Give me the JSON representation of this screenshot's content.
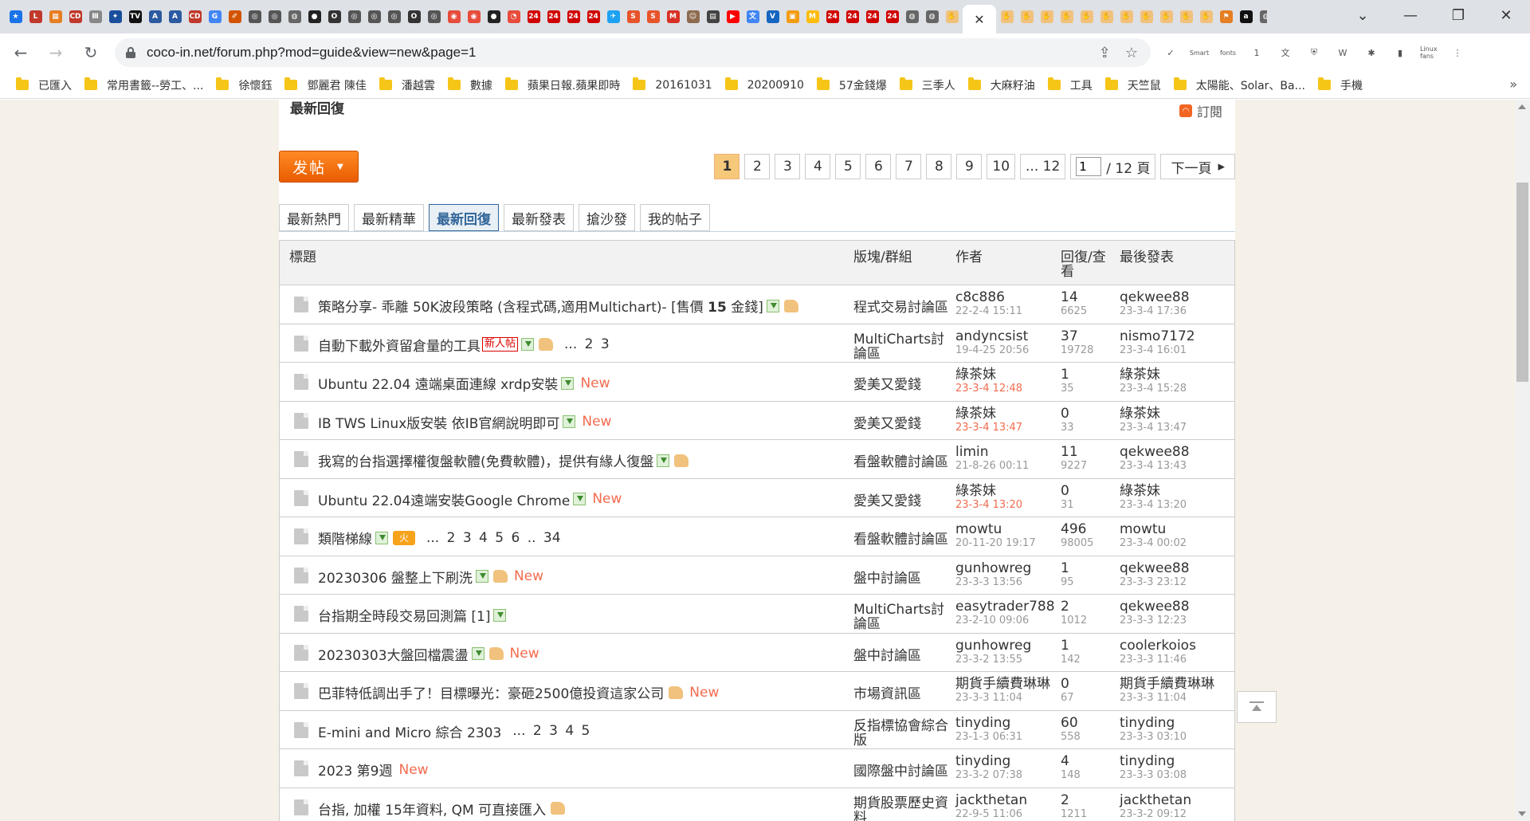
{
  "browser": {
    "tab_icons": [
      {
        "name": "star-icon",
        "glyph": "★",
        "color": "#1a73e8"
      },
      {
        "name": "red-app-icon",
        "glyph": "L",
        "color": "#c0392b"
      },
      {
        "name": "grid-app-icon",
        "glyph": "▦",
        "color": "#e67e22"
      },
      {
        "name": "cd-icon",
        "glyph": "CD",
        "color": "#c0392b"
      },
      {
        "name": "page-icon",
        "glyph": "Ⅲ",
        "color": "#888"
      },
      {
        "name": "star-box-icon",
        "glyph": "✦",
        "color": "#1a4f9c"
      },
      {
        "name": "tv-icon",
        "glyph": "TV",
        "color": "#111"
      },
      {
        "name": "ami-icon",
        "glyph": "A",
        "color": "#2b5aa0"
      },
      {
        "name": "ami2-icon",
        "glyph": "A",
        "color": "#2b5aa0"
      },
      {
        "name": "cd2-icon",
        "glyph": "CD",
        "color": "#c0392b"
      },
      {
        "name": "google-icon",
        "glyph": "G",
        "color": "#4285f4"
      },
      {
        "name": "sketch-icon",
        "glyph": "✐",
        "color": "#d35400"
      },
      {
        "name": "openai-icon",
        "glyph": "◎",
        "color": "#555"
      },
      {
        "name": "openai2-icon",
        "glyph": "◎",
        "color": "#555"
      },
      {
        "name": "globe-icon",
        "glyph": "◍",
        "color": "#666"
      },
      {
        "name": "github-icon",
        "glyph": "●",
        "color": "#222"
      },
      {
        "name": "openai-news-icon",
        "glyph": "O",
        "color": "#333"
      },
      {
        "name": "openai3-icon",
        "glyph": "◎",
        "color": "#555"
      },
      {
        "name": "openai4-icon",
        "glyph": "◎",
        "color": "#555"
      },
      {
        "name": "openai5-icon",
        "glyph": "◎",
        "color": "#555"
      },
      {
        "name": "openai-news2-icon",
        "glyph": "O",
        "color": "#333"
      },
      {
        "name": "openai6-icon",
        "glyph": "◎",
        "color": "#555"
      },
      {
        "name": "radar-icon",
        "glyph": "◉",
        "color": "#e74c3c"
      },
      {
        "name": "radar2-icon",
        "glyph": "◉",
        "color": "#e74c3c"
      },
      {
        "name": "github2-icon",
        "glyph": "●",
        "color": "#222"
      },
      {
        "name": "clock-icon",
        "glyph": "◔",
        "color": "#e74c3c"
      },
      {
        "name": "news24-icon",
        "glyph": "24",
        "color": "#d00000"
      },
      {
        "name": "news24b-icon",
        "glyph": "24",
        "color": "#d00000"
      },
      {
        "name": "news24c-icon",
        "glyph": "24",
        "color": "#d00000"
      },
      {
        "name": "news24d-icon",
        "glyph": "24",
        "color": "#d00000"
      },
      {
        "name": "twitter-icon",
        "glyph": "✈",
        "color": "#1da1f2"
      },
      {
        "name": "shop-icon",
        "glyph": "S",
        "color": "#e8542c"
      },
      {
        "name": "shop2-icon",
        "glyph": "S",
        "color": "#e8542c"
      },
      {
        "name": "gmail-icon",
        "glyph": "M",
        "color": "#d93025"
      },
      {
        "name": "avatar-icon",
        "glyph": "☺",
        "color": "#8e6b4f"
      },
      {
        "name": "newspaper-icon",
        "glyph": "▤",
        "color": "#444"
      },
      {
        "name": "youtube-icon",
        "glyph": "▶",
        "color": "#ff0000"
      },
      {
        "name": "translate-icon",
        "glyph": "文",
        "color": "#4285f4"
      },
      {
        "name": "v-icon",
        "glyph": "V",
        "color": "#1565c0"
      },
      {
        "name": "orange-app-icon",
        "glyph": "▣",
        "color": "#f39c12"
      },
      {
        "name": "mcd-icon",
        "glyph": "M",
        "color": "#ffbc0d"
      },
      {
        "name": "news24e-icon",
        "glyph": "24",
        "color": "#d00000"
      },
      {
        "name": "news24f-icon",
        "glyph": "24",
        "color": "#d00000"
      },
      {
        "name": "news24g-icon",
        "glyph": "24",
        "color": "#d00000"
      },
      {
        "name": "news24h-icon",
        "glyph": "24",
        "color": "#d00000"
      },
      {
        "name": "globe2-icon",
        "glyph": "◍",
        "color": "#666"
      },
      {
        "name": "globe3-icon",
        "glyph": "◍",
        "color": "#666"
      },
      {
        "name": "hand-icon",
        "glyph": "✋",
        "color": "#f1c27d"
      }
    ],
    "tab_icons_after": [
      {
        "name": "hand2-icon",
        "glyph": "✋",
        "color": "#f1c27d"
      },
      {
        "name": "hand3-icon",
        "glyph": "✋",
        "color": "#f1c27d"
      },
      {
        "name": "hand4-icon",
        "glyph": "✋",
        "color": "#f1c27d"
      },
      {
        "name": "hand5-icon",
        "glyph": "✋",
        "color": "#f1c27d"
      },
      {
        "name": "hand6-icon",
        "glyph": "✋",
        "color": "#f1c27d"
      },
      {
        "name": "hand7-icon",
        "glyph": "✋",
        "color": "#f1c27d"
      },
      {
        "name": "hand8-icon",
        "glyph": "✋",
        "color": "#f1c27d"
      },
      {
        "name": "hand9-icon",
        "glyph": "✋",
        "color": "#f1c27d"
      },
      {
        "name": "hand10-icon",
        "glyph": "✋",
        "color": "#f1c27d"
      },
      {
        "name": "hand11-icon",
        "glyph": "✋",
        "color": "#f1c27d"
      },
      {
        "name": "hand12-icon",
        "glyph": "✋",
        "color": "#f1c27d"
      },
      {
        "name": "flag-icon",
        "glyph": "⚑",
        "color": "#e67e22"
      },
      {
        "name": "amazon-icon",
        "glyph": "a",
        "color": "#111"
      },
      {
        "name": "globe4-icon",
        "glyph": "◍",
        "color": "#666"
      },
      {
        "name": "radio-icon",
        "glyph": "◌",
        "color": "#777"
      },
      {
        "name": "openai7-icon",
        "glyph": "◎",
        "color": "#555"
      }
    ],
    "active_tab_close": "✕",
    "new_tab_label": "+",
    "window_controls": [
      "⌄",
      "—",
      "❐",
      "✕"
    ],
    "url": "coco-in.net/forum.php?mod=guide&view=new&page=1",
    "extensions": [
      "✓",
      "Smart",
      "fonts",
      "1",
      "文",
      "⛨",
      "W",
      "✱",
      "▮",
      "Linux fans",
      "⋮"
    ]
  },
  "bookmarks": [
    "已匯入",
    "常用書籤--勞工、...",
    "徐懷鈺",
    "鄧麗君 陳佳",
    "潘越雲",
    "數據",
    "蘋果日報.蘋果即時",
    "20161031",
    "20200910",
    "57金錢爆",
    "三季人",
    "大麻籽油",
    "工具",
    "天竺鼠",
    "太陽能、Solar、Ba...",
    "手機"
  ],
  "bookmarks_more": "»",
  "page": {
    "section_title": "最新回復",
    "rss_label": "訂閱",
    "post_button": "发帖",
    "pager": {
      "pages": [
        "1",
        "2",
        "3",
        "4",
        "5",
        "6",
        "7",
        "8",
        "9",
        "10",
        "... 12"
      ],
      "current": "1",
      "input_value": "1",
      "total_label": "/ 12 頁",
      "next_label": "下一頁"
    },
    "subtabs": [
      "最新熱門",
      "最新精華",
      "最新回復",
      "最新發表",
      "搶沙發",
      "我的帖子"
    ],
    "active_subtab": "最新回復",
    "headers": {
      "title": "標題",
      "forum": "版塊/群組",
      "author": "作者",
      "stats": "回復/查看",
      "last": "最後發表"
    },
    "threads": [
      {
        "title": "策略分享- 乖離 50K波段策略 (含程式碼,適用Multichart)- [售價 ",
        "title_bold": "15",
        "title_tail": " 金錢]",
        "attach": true,
        "thumb": true,
        "newpost": "",
        "hot": false,
        "pages": "",
        "new": "",
        "forum": "程式交易討論區",
        "author": "c8c886",
        "author_date": "22-2-4 15:11",
        "author_red": false,
        "replies": "14",
        "views": "6625",
        "last_author": "qekwee88",
        "last_date": "23-3-4 17:36"
      },
      {
        "title": "自動下載外資留倉量的工具",
        "title_bold": "",
        "title_tail": "",
        "attach": true,
        "thumb": true,
        "newpost": "新人帖",
        "hot": false,
        "pages": "... 2 3",
        "new": "",
        "forum": "MultiCharts討論區",
        "author": "andyncsist",
        "author_date": "19-4-25 20:56",
        "author_red": false,
        "replies": "37",
        "views": "19728",
        "last_author": "nismo7172",
        "last_date": "23-3-4 16:01"
      },
      {
        "title": "Ubuntu 22.04 遠端桌面連線 xrdp安裝",
        "title_bold": "",
        "title_tail": "",
        "attach": true,
        "thumb": false,
        "newpost": "",
        "hot": false,
        "pages": "",
        "new": "New",
        "forum": "愛美又愛錢",
        "author": "綠茶妹",
        "author_date": "23-3-4 12:48",
        "author_red": true,
        "replies": "1",
        "views": "35",
        "last_author": "綠茶妹",
        "last_date": "23-3-4 15:28"
      },
      {
        "title": "IB TWS Linux版安裝 依IB官網說明即可",
        "title_bold": "",
        "title_tail": "",
        "attach": true,
        "thumb": false,
        "newpost": "",
        "hot": false,
        "pages": "",
        "new": "New",
        "forum": "愛美又愛錢",
        "author": "綠茶妹",
        "author_date": "23-3-4 13:47",
        "author_red": true,
        "replies": "0",
        "views": "33",
        "last_author": "綠茶妹",
        "last_date": "23-3-4 13:47"
      },
      {
        "title": "我寫的台指選擇權復盤軟體(免費軟體)，提供有緣人復盤",
        "title_bold": "",
        "title_tail": "",
        "attach": true,
        "thumb": true,
        "newpost": "",
        "hot": false,
        "pages": "",
        "new": "",
        "forum": "看盤軟體討論區",
        "author": "limin",
        "author_date": "21-8-26 00:11",
        "author_red": false,
        "replies": "11",
        "views": "9227",
        "last_author": "qekwee88",
        "last_date": "23-3-4 13:43"
      },
      {
        "title": "Ubuntu 22.04遠端安裝Google Chrome",
        "title_bold": "",
        "title_tail": "",
        "attach": true,
        "thumb": false,
        "newpost": "",
        "hot": false,
        "pages": "",
        "new": "New",
        "forum": "愛美又愛錢",
        "author": "綠茶妹",
        "author_date": "23-3-4 13:20",
        "author_red": true,
        "replies": "0",
        "views": "31",
        "last_author": "綠茶妹",
        "last_date": "23-3-4 13:20"
      },
      {
        "title": "類階梯線",
        "title_bold": "",
        "title_tail": "",
        "attach": true,
        "thumb": false,
        "newpost": "",
        "hot": true,
        "pages": "... 2 3 4 5 6 .. 34",
        "new": "",
        "forum": "看盤軟體討論區",
        "author": "mowtu",
        "author_date": "20-11-20 19:17",
        "author_red": false,
        "replies": "496",
        "views": "98005",
        "last_author": "mowtu",
        "last_date": "23-3-4 00:02"
      },
      {
        "title": "20230306 盤整上下刷洗",
        "title_bold": "",
        "title_tail": "",
        "attach": true,
        "thumb": true,
        "newpost": "",
        "hot": false,
        "pages": "",
        "new": "New",
        "forum": "盤中討論區",
        "author": "gunhowreg",
        "author_date": "23-3-3 13:56",
        "author_red": false,
        "replies": "1",
        "views": "95",
        "last_author": "qekwee88",
        "last_date": "23-3-3 23:12"
      },
      {
        "title": "台指期全時段交易回測篇 [1]",
        "title_bold": "",
        "title_tail": "",
        "attach": true,
        "thumb": false,
        "newpost": "",
        "hot": false,
        "pages": "",
        "new": "",
        "forum": "MultiCharts討論區",
        "author": "easytrader788",
        "author_date": "23-2-10 09:06",
        "author_red": false,
        "replies": "2",
        "views": "1012",
        "last_author": "qekwee88",
        "last_date": "23-3-3 12:23"
      },
      {
        "title": "20230303大盤回檔震盪",
        "title_bold": "",
        "title_tail": "",
        "attach": true,
        "thumb": true,
        "newpost": "",
        "hot": false,
        "pages": "",
        "new": "New",
        "forum": "盤中討論區",
        "author": "gunhowreg",
        "author_date": "23-3-2 13:55",
        "author_red": false,
        "replies": "1",
        "views": "142",
        "last_author": "coolerkoios",
        "last_date": "23-3-3 11:46"
      },
      {
        "title": "巴菲特低調出手了！目標曝光：豪砸2500億投資這家公司",
        "title_bold": "",
        "title_tail": "",
        "attach": false,
        "thumb": true,
        "newpost": "",
        "hot": false,
        "pages": "",
        "new": "New",
        "forum": "市場資訊區",
        "author": "期貨手續費琳琳",
        "author_date": "23-3-3 11:04",
        "author_red": false,
        "replies": "0",
        "views": "67",
        "last_author": "期貨手續費琳琳",
        "last_date": "23-3-3 11:04"
      },
      {
        "title": "E-mini and Micro 綜合 2303",
        "title_bold": "",
        "title_tail": "",
        "attach": false,
        "thumb": false,
        "newpost": "",
        "hot": false,
        "pages": "... 2 3 4 5",
        "new": "",
        "forum": "反指標協會綜合版",
        "author": "tinyding",
        "author_date": "23-1-3 06:31",
        "author_red": false,
        "replies": "60",
        "views": "558",
        "last_author": "tinyding",
        "last_date": "23-3-3 03:10"
      },
      {
        "title": "2023 第9週",
        "title_bold": "",
        "title_tail": "",
        "attach": false,
        "thumb": false,
        "newpost": "",
        "hot": false,
        "pages": "",
        "new": "New",
        "forum": "國際盤中討論區",
        "author": "tinyding",
        "author_date": "23-3-2 07:38",
        "author_red": false,
        "replies": "4",
        "views": "148",
        "last_author": "tinyding",
        "last_date": "23-3-3 03:08"
      },
      {
        "title": "台指, 加權 15年資料, QM 可直接匯入",
        "title_bold": "",
        "title_tail": "",
        "attach": false,
        "thumb": true,
        "newpost": "",
        "hot": false,
        "pages": "",
        "new": "",
        "forum": "期貨股票歷史資料",
        "author": "jackthetan",
        "author_date": "22-9-5 11:06",
        "author_red": false,
        "replies": "2",
        "views": "1211",
        "last_author": "jackthetan",
        "last_date": "23-3-2 09:12"
      }
    ]
  }
}
